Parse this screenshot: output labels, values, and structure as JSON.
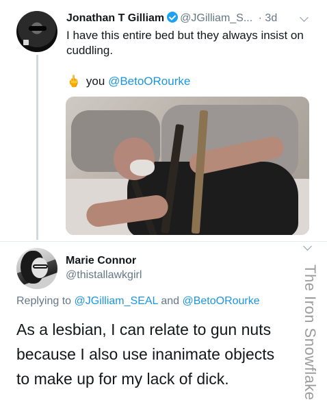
{
  "tweet1": {
    "name": "Jonathan T Gilliam",
    "handle": "@JGilliam_S...",
    "separator": "·",
    "time": "3d",
    "text": "I have this entire bed but they always insist on cuddling.",
    "reply_emoji": "🖕",
    "reply_word": "you",
    "reply_mention": "@BetoORourke",
    "icons": {
      "verified": "verified-badge-icon",
      "more": "chevron-down-icon",
      "gesture": "middle-finger-emoji-icon"
    },
    "photo_label": "bed-with-rifles-photo"
  },
  "tweet2": {
    "name": "Marie Connor",
    "handle": "@thistallawkgirl",
    "replying_prefix": "Replying to",
    "replying_user1": "@JGilliam_SEAL",
    "replying_and": "and",
    "replying_user2": "@BetoORourke",
    "text": "As a lesbian, I can relate to gun nuts because I also use inanimate objects to make up for my lack of dick.",
    "icons": {
      "more": "chevron-down-icon"
    }
  },
  "watermark": "The Iron Snowflake",
  "colors": {
    "link": "#1b95e0",
    "secondary": "#657786",
    "verified": "#1da1f2",
    "text": "#14171a"
  }
}
